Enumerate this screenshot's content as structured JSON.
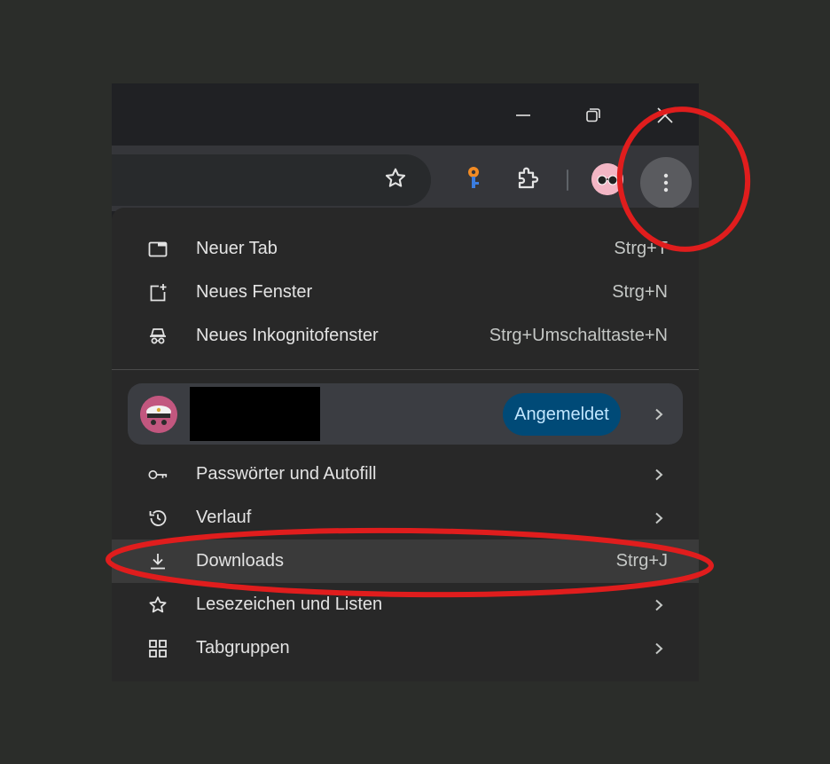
{
  "window": {
    "minimize_icon": "minimize-icon",
    "restore_icon": "restore-icon",
    "close_icon": "close-icon"
  },
  "toolbar": {
    "bookmark_icon": "star-outline-icon",
    "extension_1_icon": "key-icon",
    "extension_2_icon": "puzzle-icon",
    "profile_icon": "avatar-sunglasses",
    "menu_icon": "three-dots-vertical-icon"
  },
  "menu": {
    "items_top": [
      {
        "label": "Neuer Tab",
        "shortcut": "Strg+T",
        "icon": "new-tab-icon"
      },
      {
        "label": "Neues Fenster",
        "shortcut": "Strg+N",
        "icon": "new-window-icon"
      },
      {
        "label": "Neues Inkognitofenster",
        "shortcut": "Strg+Umschalttaste+N",
        "icon": "incognito-icon"
      }
    ],
    "profile": {
      "status": "Angemeldet",
      "avatar_icon": "avatar-captain-hat"
    },
    "items_bottom": [
      {
        "label": "Passwörter und Autofill",
        "icon": "key-icon",
        "submenu": true
      },
      {
        "label": "Verlauf",
        "icon": "history-icon",
        "submenu": true
      },
      {
        "label": "Downloads",
        "shortcut": "Strg+J",
        "icon": "download-icon",
        "highlighted": true
      },
      {
        "label": "Lesezeichen und Listen",
        "icon": "star-outline-icon",
        "submenu": true
      },
      {
        "label": "Tabgruppen",
        "icon": "tab-groups-icon",
        "submenu": true
      }
    ]
  },
  "colors": {
    "page_bg": "#2b2d2a",
    "menu_bg": "#282828",
    "highlight_bg": "#3a3a3a",
    "pill_bg": "#004a77",
    "annotation_red": "#e01d1d"
  }
}
